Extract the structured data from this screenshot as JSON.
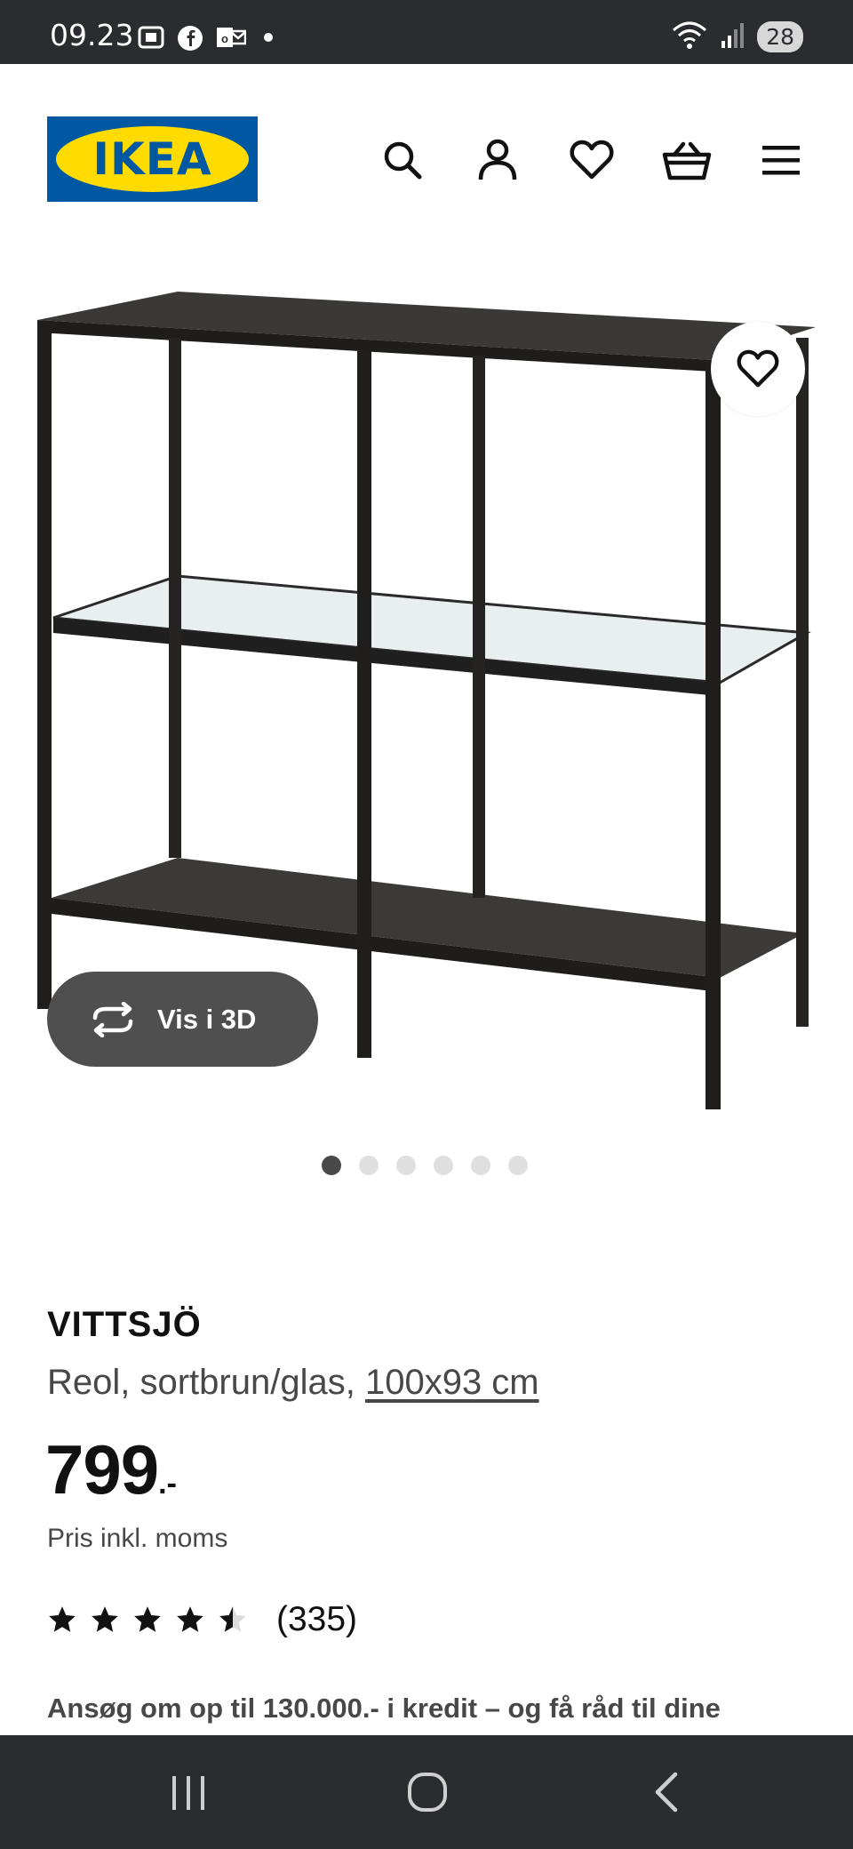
{
  "status_bar": {
    "time": "09.23",
    "battery": "28",
    "icons": [
      "screenshot-icon",
      "facebook-icon",
      "outlook-icon",
      "wifi-icon",
      "signal-icon"
    ]
  },
  "header": {
    "logo_text": "IKEA",
    "brand_colors": {
      "blue": "#0058a3",
      "yellow": "#ffdb00"
    },
    "icons": [
      "search-icon",
      "account-icon",
      "favorites-icon",
      "basket-icon",
      "menu-icon"
    ]
  },
  "gallery": {
    "vis3d_label": "Vis i 3D",
    "image_count": 6,
    "active_index": 0
  },
  "product": {
    "name": "VITTSJÖ",
    "description": "Reol, sortbrun/glas, ",
    "dimensions": "100x93 cm",
    "price": "799",
    "price_suffix": ".-",
    "price_note": "Pris inkl. moms",
    "rating_value": 4.5,
    "rating_max": 5,
    "review_count": "(335)",
    "credit_text": "Ansøg om op til 130.000.- i kredit – og få råd til dine"
  },
  "nav_bar": {
    "icons": [
      "recent-apps-icon",
      "home-icon",
      "back-icon"
    ]
  }
}
